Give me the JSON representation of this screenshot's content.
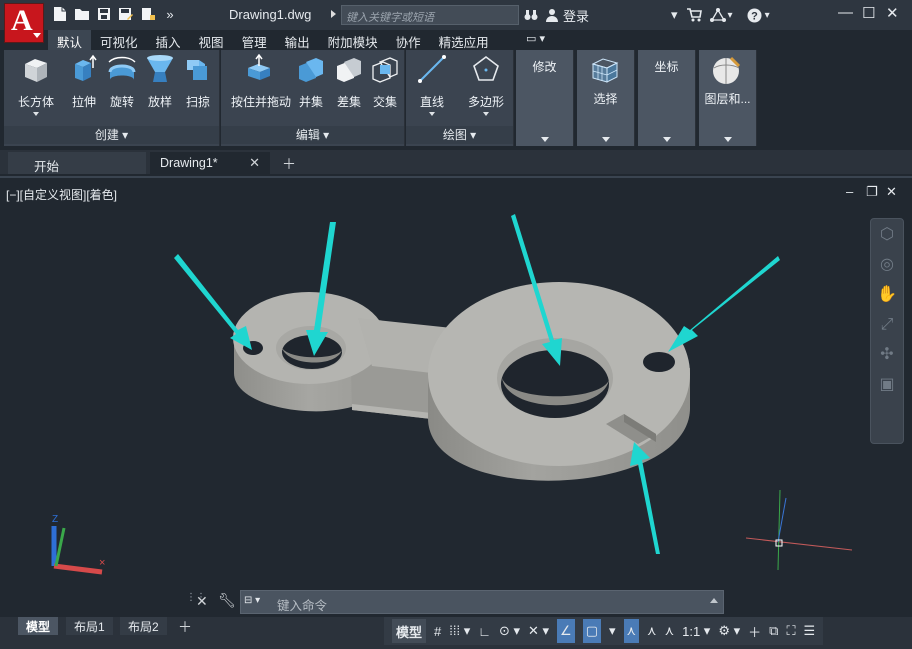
{
  "titlebar": {
    "doc_title": "Drawing1.dwg",
    "search_placeholder": "键入关键字或短语",
    "login_label": "登录",
    "app_letter": "A"
  },
  "ribbon": {
    "tabs": [
      "默认",
      "可视化",
      "插入",
      "视图",
      "管理",
      "输出",
      "附加模块",
      "协作",
      "精选应用"
    ],
    "active_tab": "默认",
    "panels": {
      "create": {
        "label": "创建",
        "tools": [
          "长方体",
          "拉伸",
          "旋转",
          "放样",
          "扫掠"
        ]
      },
      "edit": {
        "label": "编辑",
        "tools": [
          "按住并拖动",
          "并集",
          "差集",
          "交集"
        ]
      },
      "draw": {
        "label": "绘图",
        "tools": [
          "直线",
          "多边形"
        ]
      },
      "modify": {
        "label": "修改"
      },
      "select": {
        "label": "选择"
      },
      "coords": {
        "label": "坐标"
      },
      "layers": {
        "label": "图层和..."
      }
    }
  },
  "filetabs": {
    "start": "开始",
    "drawing": "Drawing1*"
  },
  "viewport": {
    "view_label": "[−][自定义视图][着色]"
  },
  "command": {
    "placeholder": "键入命令"
  },
  "statusbar": {
    "layout_tabs": [
      "模型",
      "布局1",
      "布局2"
    ],
    "model_button": "模型",
    "scale": "1:1"
  },
  "colors": {
    "accent_arrow": "#1fd6d0",
    "app_red": "#c8161d",
    "toggle_on": "#4a7bb6"
  }
}
